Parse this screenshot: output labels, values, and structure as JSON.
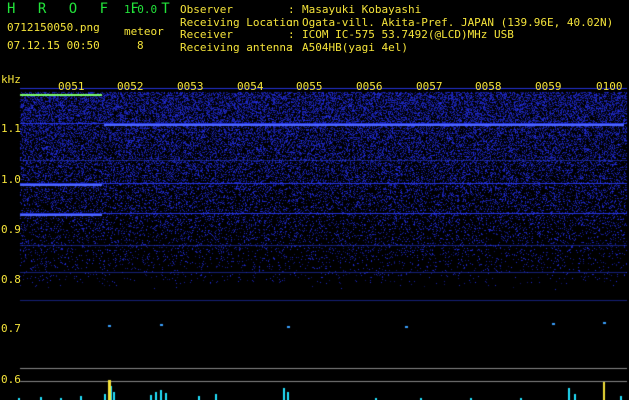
{
  "app": {
    "name": "H R O F F T",
    "version": "1.0.0"
  },
  "file": {
    "name": "0712150050.png",
    "datetime": "07.12.15 00:50"
  },
  "meteor": {
    "label": "meteor",
    "count": "8"
  },
  "info": [
    {
      "key": "Observer",
      "value": "Masayuki Kobayashi"
    },
    {
      "key": "Receiving Location",
      "value": "Ogata-vill. Akita-Pref. JAPAN (139.96E, 40.02N)"
    },
    {
      "key": "Receiver",
      "value": "ICOM IC-575 53.7492(@LCD)MHz USB"
    },
    {
      "key": "Receiving antenna",
      "value": "A504HB(yagi 4el)"
    }
  ],
  "colors": {
    "text": "#f4e33a",
    "logo": "#22e33a",
    "signal": "#2a3cff",
    "spike": "#22e3ff"
  },
  "chart_data": {
    "type": "heatmap",
    "ylabel": "kHz",
    "y_ticks": [
      "1.1",
      "1.0",
      "0.9",
      "0.8",
      "0.7",
      "0.6"
    ],
    "x_ticks": [
      "0051",
      "0052",
      "0053",
      "0054",
      "0055",
      "0056",
      "0057",
      "0058",
      "0059",
      "0100"
    ],
    "echo_lines_khz": [
      1.18,
      1.11,
      0.99,
      0.93
    ]
  }
}
